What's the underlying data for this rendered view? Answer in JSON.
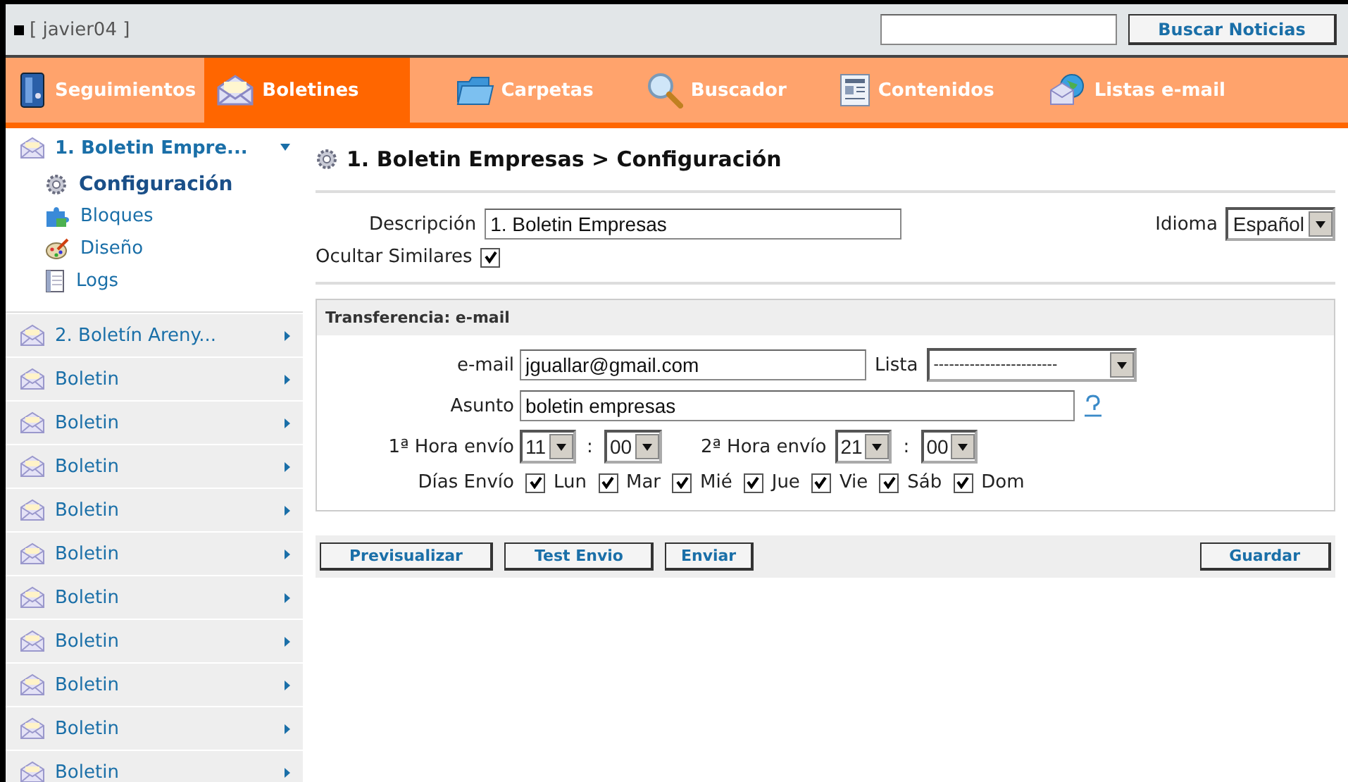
{
  "header": {
    "user": "[ javier04 ]",
    "search_button": "Buscar Noticias"
  },
  "nav": [
    {
      "label": "Seguimientos",
      "kind": "binder",
      "selected": false
    },
    {
      "label": "Boletines",
      "kind": "envelope",
      "selected": true
    },
    {
      "label": "Carpetas",
      "kind": "folder",
      "selected": false
    },
    {
      "label": "Buscador",
      "kind": "magnifier",
      "selected": false
    },
    {
      "label": "Contenidos",
      "kind": "document",
      "selected": false
    },
    {
      "label": "Listas e-mail",
      "kind": "globe",
      "selected": false
    }
  ],
  "sidebar": {
    "items": [
      {
        "label": "1. Boletin Empre...",
        "expanded": true,
        "children": [
          {
            "label": "Configuración",
            "kind": "gear",
            "selected": true
          },
          {
            "label": "Bloques",
            "kind": "puzzle",
            "selected": false
          },
          {
            "label": "Diseño",
            "kind": "palette",
            "selected": false
          },
          {
            "label": "Logs",
            "kind": "notebook",
            "selected": false
          }
        ]
      },
      {
        "label": "2. Boletín Areny...",
        "expanded": false
      },
      {
        "label": "Boletin",
        "expanded": false
      },
      {
        "label": "Boletin",
        "expanded": false
      },
      {
        "label": "Boletin",
        "expanded": false
      },
      {
        "label": "Boletin",
        "expanded": false
      },
      {
        "label": "Boletin",
        "expanded": false
      },
      {
        "label": "Boletin",
        "expanded": false
      },
      {
        "label": "Boletin",
        "expanded": false
      },
      {
        "label": "Boletin",
        "expanded": false
      },
      {
        "label": "Boletin",
        "expanded": false
      },
      {
        "label": "Boletin",
        "expanded": false
      }
    ]
  },
  "main": {
    "title": "1. Boletin Empresas > Configuración",
    "descripcion": {
      "label": "Descripción",
      "value": "1. Boletin Empresas"
    },
    "idioma": {
      "label": "Idioma",
      "value": "Español"
    },
    "ocultar_similares": {
      "label": "Ocultar Similares",
      "checked": true
    },
    "transfer": {
      "title": "Transferencia: e-mail",
      "email": {
        "label": "e-mail",
        "value": "jguallar@gmail.com"
      },
      "lista": {
        "label": "Lista",
        "value": "------------------------"
      },
      "asunto": {
        "label": "Asunto",
        "value": "boletin empresas"
      },
      "hora1": {
        "label": "1ª Hora envío",
        "hour": "11",
        "minute": "00",
        "separator": ":"
      },
      "hora2": {
        "label": "2ª Hora envío",
        "hour": "21",
        "minute": "00",
        "separator": ":"
      },
      "dias": {
        "label": "Días Envío",
        "days": [
          {
            "label": "Lun",
            "checked": true
          },
          {
            "label": "Mar",
            "checked": true
          },
          {
            "label": "Mié",
            "checked": true
          },
          {
            "label": "Jue",
            "checked": true
          },
          {
            "label": "Vie",
            "checked": true
          },
          {
            "label": "Sáb",
            "checked": true
          },
          {
            "label": "Dom",
            "checked": true
          }
        ]
      }
    },
    "buttons": [
      "Previsualizar",
      "Test Envio",
      "Enviar"
    ],
    "save_button": "Guardar"
  }
}
